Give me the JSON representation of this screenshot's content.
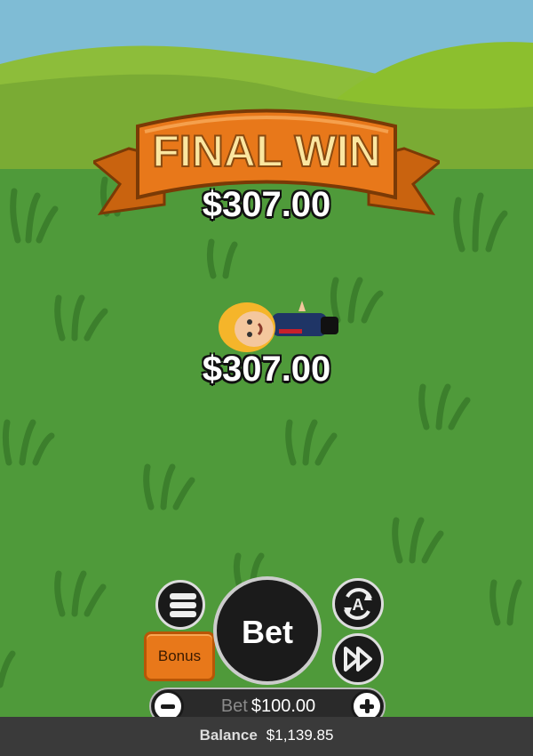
{
  "banner": {
    "title": "FINAL WIN"
  },
  "final_win": {
    "amount": "$307.00"
  },
  "character_win": {
    "amount": "$307.00"
  },
  "controls": {
    "bet_label": "Bet",
    "bonus_label": "Bonus",
    "autoplay_letter": "A"
  },
  "bet_stepper": {
    "label": "Bet",
    "value": "$100.00"
  },
  "balance": {
    "label": "Balance",
    "value": "$1,139.85"
  },
  "colors": {
    "sky": "#7fbcd5",
    "grass": "#4f9a3a",
    "banner_orange": "#e8781a",
    "banner_text": "#fbe6a0"
  },
  "icons": [
    "menu-icon",
    "autoplay-icon",
    "fast-forward-icon",
    "minus-icon",
    "plus-icon"
  ]
}
